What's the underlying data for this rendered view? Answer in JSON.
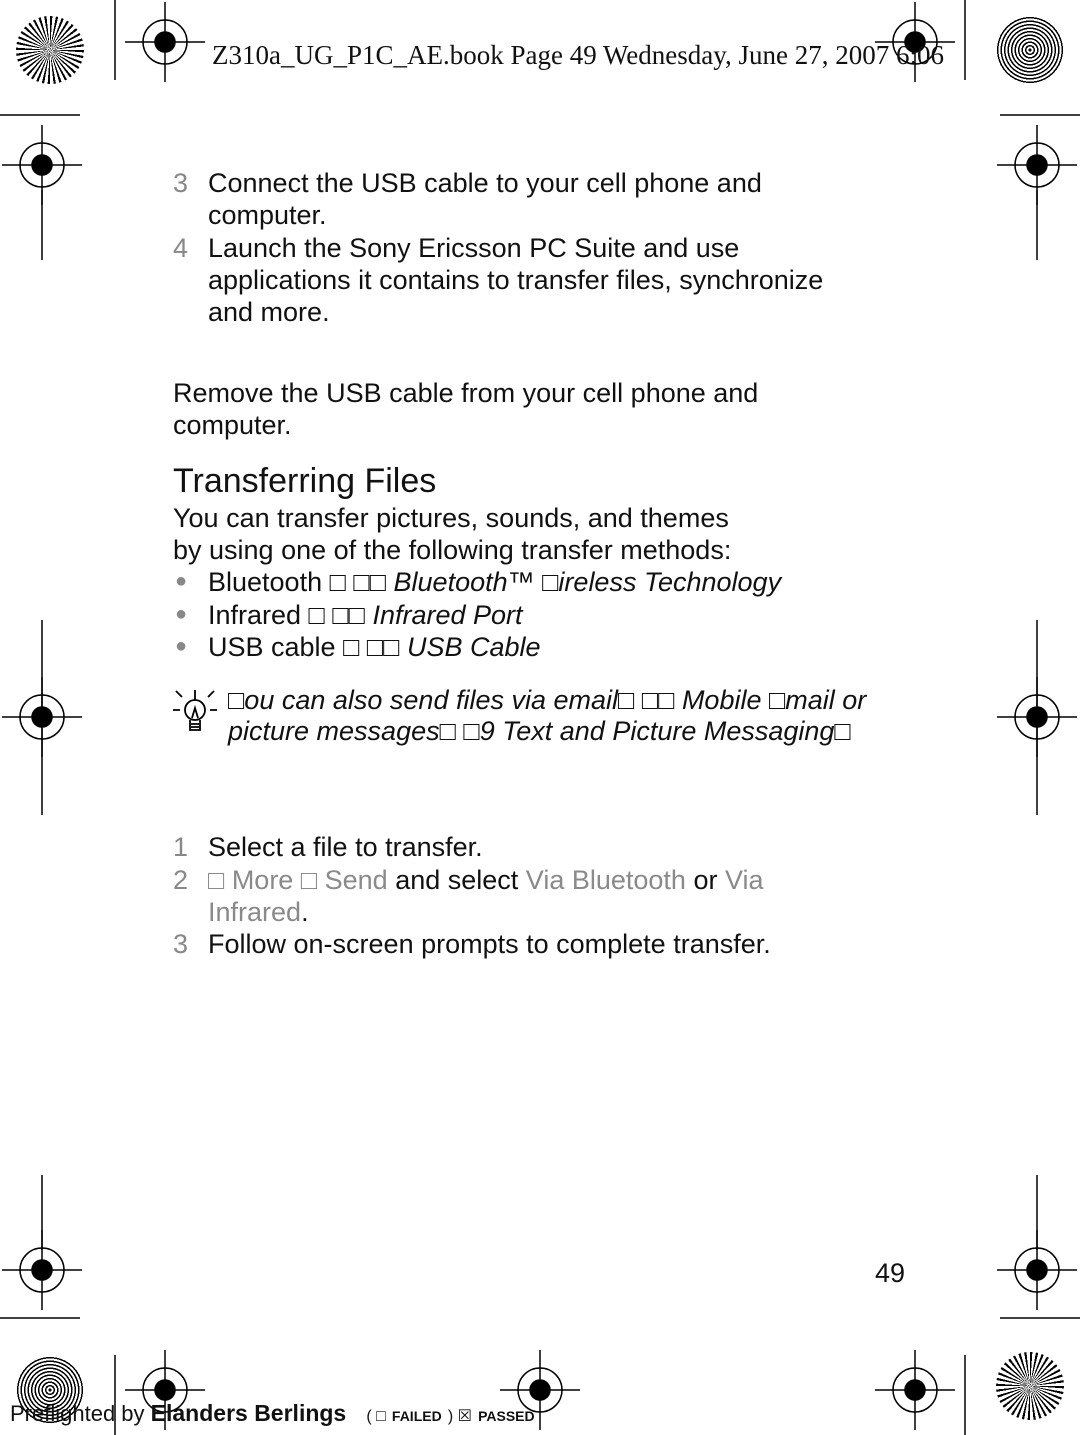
{
  "header": {
    "text": "Z310a_UG_P1C_AE.book  Page 49  Wednesday, June 27, 2007  6:06"
  },
  "steps_a": [
    {
      "n": "3",
      "lines": [
        "Connect the USB cable to your cell phone and",
        "computer."
      ]
    },
    {
      "n": "4",
      "lines": [
        "Launch the Sony Ericsson PC Suite and use",
        "applications it contains to transfer files, synchronize",
        "and more."
      ]
    }
  ],
  "remove": {
    "lines": [
      "Remove the USB cable from your cell phone and",
      "computer."
    ]
  },
  "section": {
    "title": "Transferring Files",
    "intro": [
      "You can transfer pictures, sounds, and themes",
      "by using one of the following transfer methods:"
    ]
  },
  "bullets": [
    {
      "plain": "Bluetooth □  □□ ",
      "ital": "Bluetooth™ □ireless Technology"
    },
    {
      "plain": "Infrared □  □□ ",
      "ital": "Infrared Port"
    },
    {
      "plain": "USB cable □  □□ ",
      "ital": "USB Cable"
    }
  ],
  "tip": {
    "lines": [
      "□ou can also send files via email□  □□ Mobile □mail or",
      "picture messages□  □9 Text and Picture Messaging□"
    ]
  },
  "steps_b": {
    "s1": {
      "n": "1",
      "text": "Select a file to transfer."
    },
    "s2": {
      "n": "2",
      "a": "□ ",
      "more": "More",
      "b": " □ ",
      "send": "Send",
      "c": " and select ",
      "via_bt": "Via Bluetooth",
      "d": " or ",
      "via_ir1": "Via",
      "via_ir2": "Infrared",
      "e": "."
    },
    "s3": {
      "n": "3",
      "text": "Follow on-screen prompts to complete transfer."
    }
  },
  "page_number": "49",
  "footer": {
    "preflight": "Preflighted by",
    "brand": "Elanders Berlings",
    "failed": "FAILED",
    "passed": "PASSED",
    "failed_box": "( □",
    "passed_box": ") ☒"
  }
}
